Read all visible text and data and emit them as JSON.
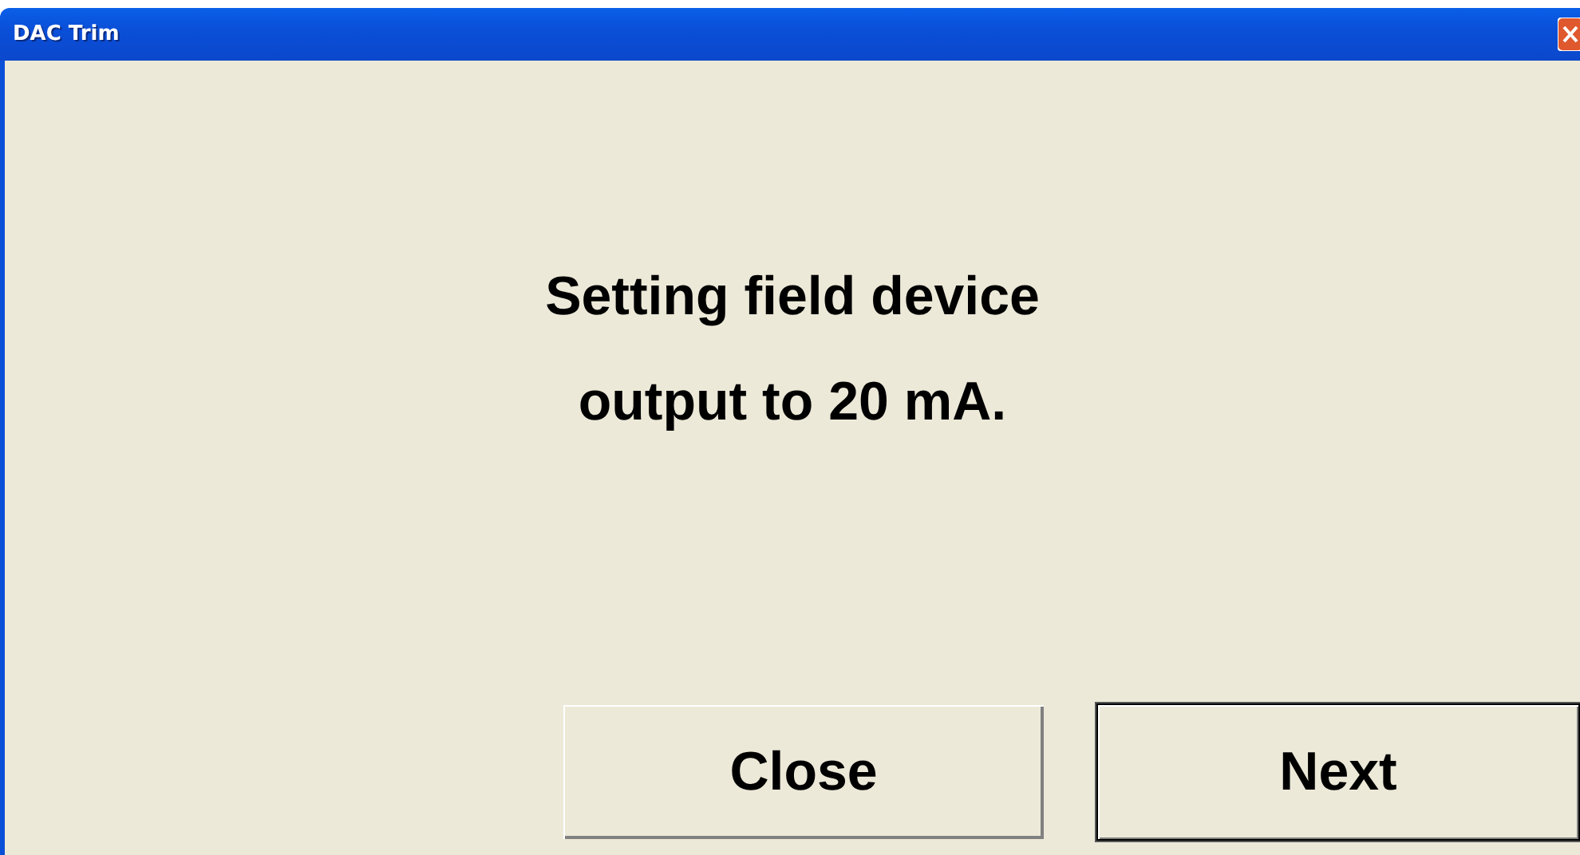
{
  "window": {
    "title": "DAC Trim"
  },
  "message": [
    "Setting field device",
    "output to 20 mA."
  ],
  "buttons": [
    {
      "label": "Close",
      "default": false
    },
    {
      "label": "Next",
      "default": true
    }
  ]
}
